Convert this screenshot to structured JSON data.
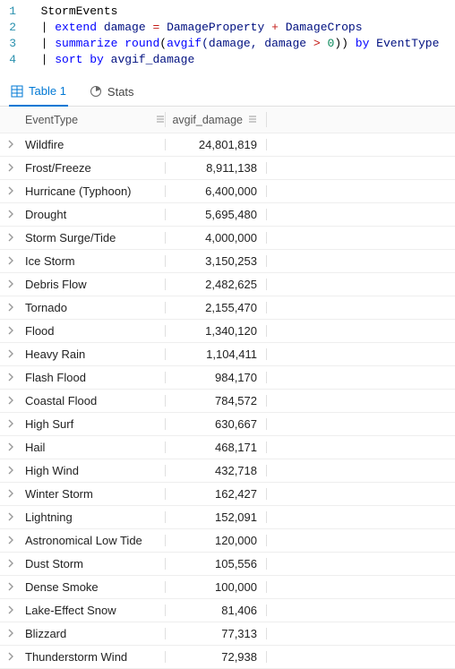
{
  "editor": {
    "lines": [
      {
        "no": "1",
        "tokens": [
          {
            "t": "StormEvents",
            "c": "id"
          }
        ]
      },
      {
        "no": "2",
        "tokens": [
          {
            "t": "| ",
            "c": "pipe"
          },
          {
            "t": "extend",
            "c": "kw"
          },
          {
            "t": " damage ",
            "c": "col"
          },
          {
            "t": "=",
            "c": "op"
          },
          {
            "t": " DamageProperty ",
            "c": "col"
          },
          {
            "t": "+",
            "c": "op"
          },
          {
            "t": " DamageCrops",
            "c": "col"
          }
        ]
      },
      {
        "no": "3",
        "tokens": [
          {
            "t": "| ",
            "c": "pipe"
          },
          {
            "t": "summarize",
            "c": "kw"
          },
          {
            "t": " ",
            "c": "id"
          },
          {
            "t": "round",
            "c": "fn"
          },
          {
            "t": "(",
            "c": "id"
          },
          {
            "t": "avgif",
            "c": "fn"
          },
          {
            "t": "(damage, damage ",
            "c": "col"
          },
          {
            "t": ">",
            "c": "op"
          },
          {
            "t": " ",
            "c": "id"
          },
          {
            "t": "0",
            "c": "num"
          },
          {
            "t": ")) ",
            "c": "id"
          },
          {
            "t": "by",
            "c": "by"
          },
          {
            "t": " EventType",
            "c": "col"
          }
        ]
      },
      {
        "no": "4",
        "tokens": [
          {
            "t": "| ",
            "c": "pipe"
          },
          {
            "t": "sort",
            "c": "kw"
          },
          {
            "t": " ",
            "c": "id"
          },
          {
            "t": "by",
            "c": "by"
          },
          {
            "t": " avgif_damage",
            "c": "col"
          }
        ]
      }
    ]
  },
  "tabs": {
    "table": "Table 1",
    "stats": "Stats"
  },
  "columns": {
    "event": "EventType",
    "damage": "avgif_damage"
  },
  "rows": [
    {
      "event": "Wildfire",
      "damage": "24,801,819"
    },
    {
      "event": "Frost/Freeze",
      "damage": "8,911,138"
    },
    {
      "event": "Hurricane (Typhoon)",
      "damage": "6,400,000"
    },
    {
      "event": "Drought",
      "damage": "5,695,480"
    },
    {
      "event": "Storm Surge/Tide",
      "damage": "4,000,000"
    },
    {
      "event": "Ice Storm",
      "damage": "3,150,253"
    },
    {
      "event": "Debris Flow",
      "damage": "2,482,625"
    },
    {
      "event": "Tornado",
      "damage": "2,155,470"
    },
    {
      "event": "Flood",
      "damage": "1,340,120"
    },
    {
      "event": "Heavy Rain",
      "damage": "1,104,411"
    },
    {
      "event": "Flash Flood",
      "damage": "984,170"
    },
    {
      "event": "Coastal Flood",
      "damage": "784,572"
    },
    {
      "event": "High Surf",
      "damage": "630,667"
    },
    {
      "event": "Hail",
      "damage": "468,171"
    },
    {
      "event": "High Wind",
      "damage": "432,718"
    },
    {
      "event": "Winter Storm",
      "damage": "162,427"
    },
    {
      "event": "Lightning",
      "damage": "152,091"
    },
    {
      "event": "Astronomical Low Tide",
      "damage": "120,000"
    },
    {
      "event": "Dust Storm",
      "damage": "105,556"
    },
    {
      "event": "Dense Smoke",
      "damage": "100,000"
    },
    {
      "event": "Lake-Effect Snow",
      "damage": "81,406"
    },
    {
      "event": "Blizzard",
      "damage": "77,313"
    },
    {
      "event": "Thunderstorm Wind",
      "damage": "72,938"
    }
  ]
}
